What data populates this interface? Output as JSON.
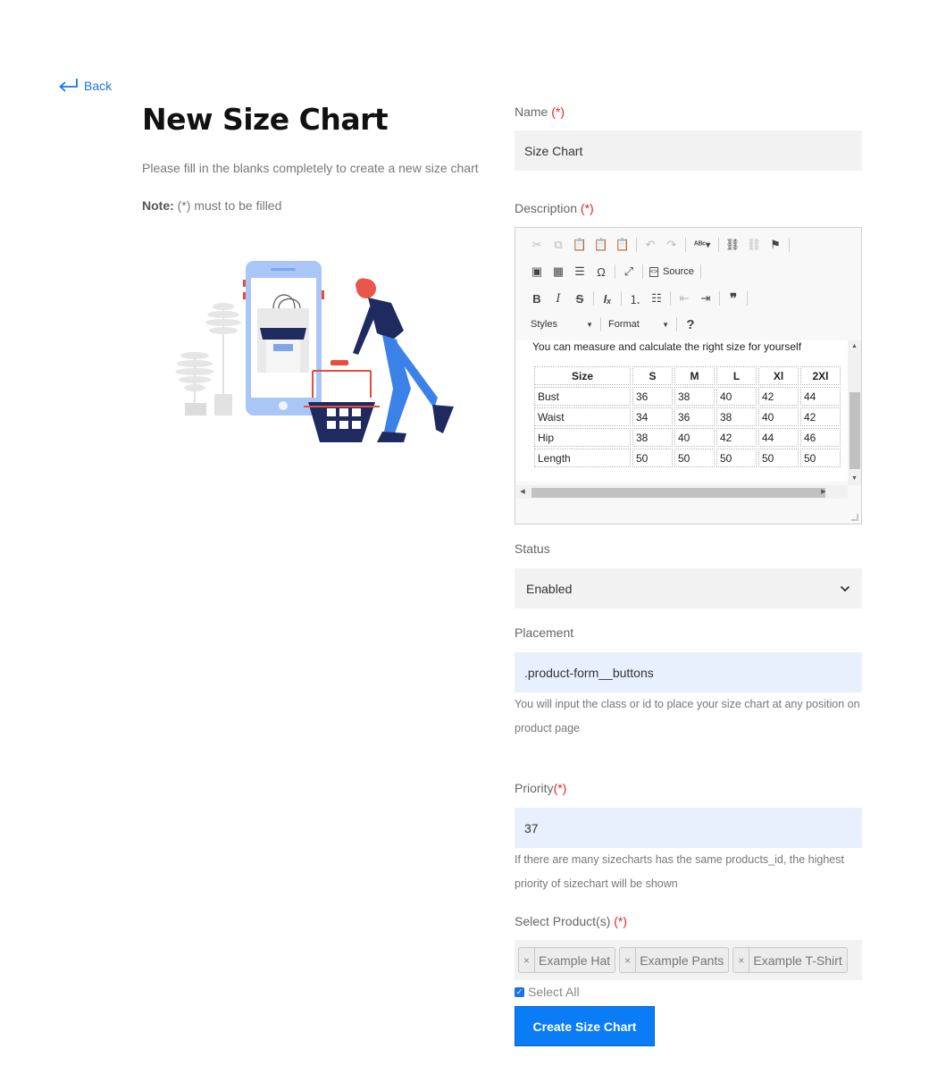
{
  "nav": {
    "back_label": "Back"
  },
  "header": {
    "title": "New Size Chart",
    "subtitle": "Please fill in the blanks completely to create a new size chart",
    "note_bold": "Note:",
    "note_text": "(*) must to be filled"
  },
  "form": {
    "required_mark": "(*)",
    "name": {
      "label": "Name",
      "value": "Size Chart"
    },
    "description": {
      "label": "Description",
      "toolbar": {
        "source_label": "Source",
        "styles_label": "Styles",
        "format_label": "Format",
        "help_label": "?"
      },
      "intro_text": "You can measure and calculate the right size for yourself",
      "table": {
        "headers": [
          "Size",
          "S",
          "M",
          "L",
          "Xl",
          "2Xl"
        ],
        "rows": [
          [
            "Bust",
            "36",
            "38",
            "40",
            "42",
            "44"
          ],
          [
            "Waist",
            "34",
            "36",
            "38",
            "40",
            "42"
          ],
          [
            "Hip",
            "38",
            "40",
            "42",
            "44",
            "46"
          ],
          [
            "Length",
            "50",
            "50",
            "50",
            "50",
            "50"
          ]
        ]
      }
    },
    "status": {
      "label": "Status",
      "selected": "Enabled"
    },
    "placement": {
      "label": "Placement",
      "value": ".product-form__buttons",
      "help": "You will input the class or id to place your size chart at any position on product page"
    },
    "priority": {
      "label": "Priority",
      "value": "37",
      "help": "If there are many sizecharts has the same products_id, the highest priority of sizechart will be shown"
    },
    "products": {
      "label": "Select Product(s)",
      "remove_glyph": "×",
      "tags": [
        "Example Hat",
        "Example Pants",
        "Example T-Shirt"
      ],
      "select_all_label": "Select All",
      "select_all_checked": true
    },
    "submit_label": "Create Size Chart"
  },
  "colors": {
    "accent": "#0a7cf5",
    "link": "#1a73e8",
    "required": "#e02424",
    "input_bg": "#f2f2f2",
    "input_focus_bg": "#e8f0fe"
  }
}
